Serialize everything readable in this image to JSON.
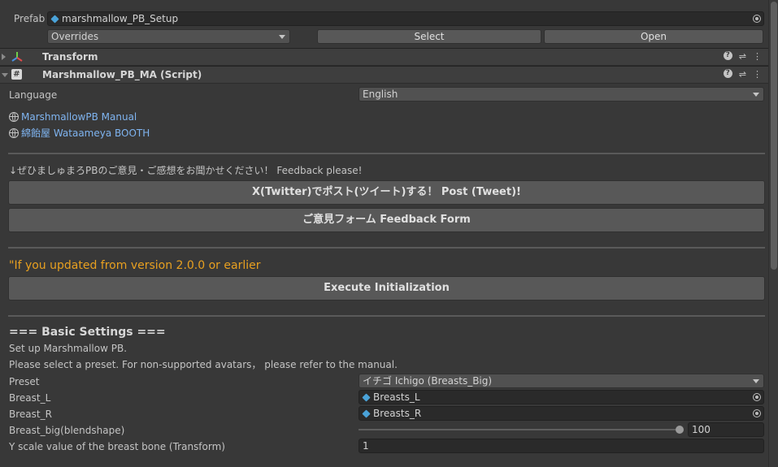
{
  "prefab": {
    "label": "Prefab",
    "value": "marshmallow_PB_Setup",
    "overrides": "Overrides",
    "select": "Select",
    "open": "Open"
  },
  "components": [
    {
      "title": "Transform",
      "expanded": false
    },
    {
      "title": "Marshmallow_PB_MA (Script)",
      "expanded": true
    }
  ],
  "language": {
    "label": "Language",
    "value": "English"
  },
  "links": [
    {
      "text": "MarshmallowPB Manual"
    },
    {
      "text": "綿飴屋 Wataameya BOOTH"
    }
  ],
  "feedback": {
    "prompt": "↓ぜひましゅまろPBのご意見・ご感想をお聞かせください！ Feedback please!",
    "post_button": "X(Twitter)でポスト(ツイート)する！ Post (Tweet)!",
    "form_button": "ご意見フォーム Feedback Form"
  },
  "update": {
    "warning": "\"If you updated from version 2.0.0 or earlier",
    "warning_color": "#e8a020",
    "execute_button": "Execute Initialization"
  },
  "basic": {
    "heading": "=== Basic Settings ===",
    "desc1": "Set up Marshmallow PB.",
    "desc2": "Please select a preset. For non-supported avatars， please refer to the manual.",
    "preset_label": "Preset",
    "preset_value": "イチゴ Ichigo (Breasts_Big)",
    "breast_l_label": "Breast_L",
    "breast_l_value": "Breasts_L",
    "breast_r_label": "Breast_R",
    "breast_r_value": "Breasts_R",
    "blend_label": "Breast_big(blendshape)",
    "blend_value": "100",
    "blend_level": 1.0,
    "yscale_label": "Y scale value of the breast bone (Transform)",
    "yscale_value": "1"
  }
}
